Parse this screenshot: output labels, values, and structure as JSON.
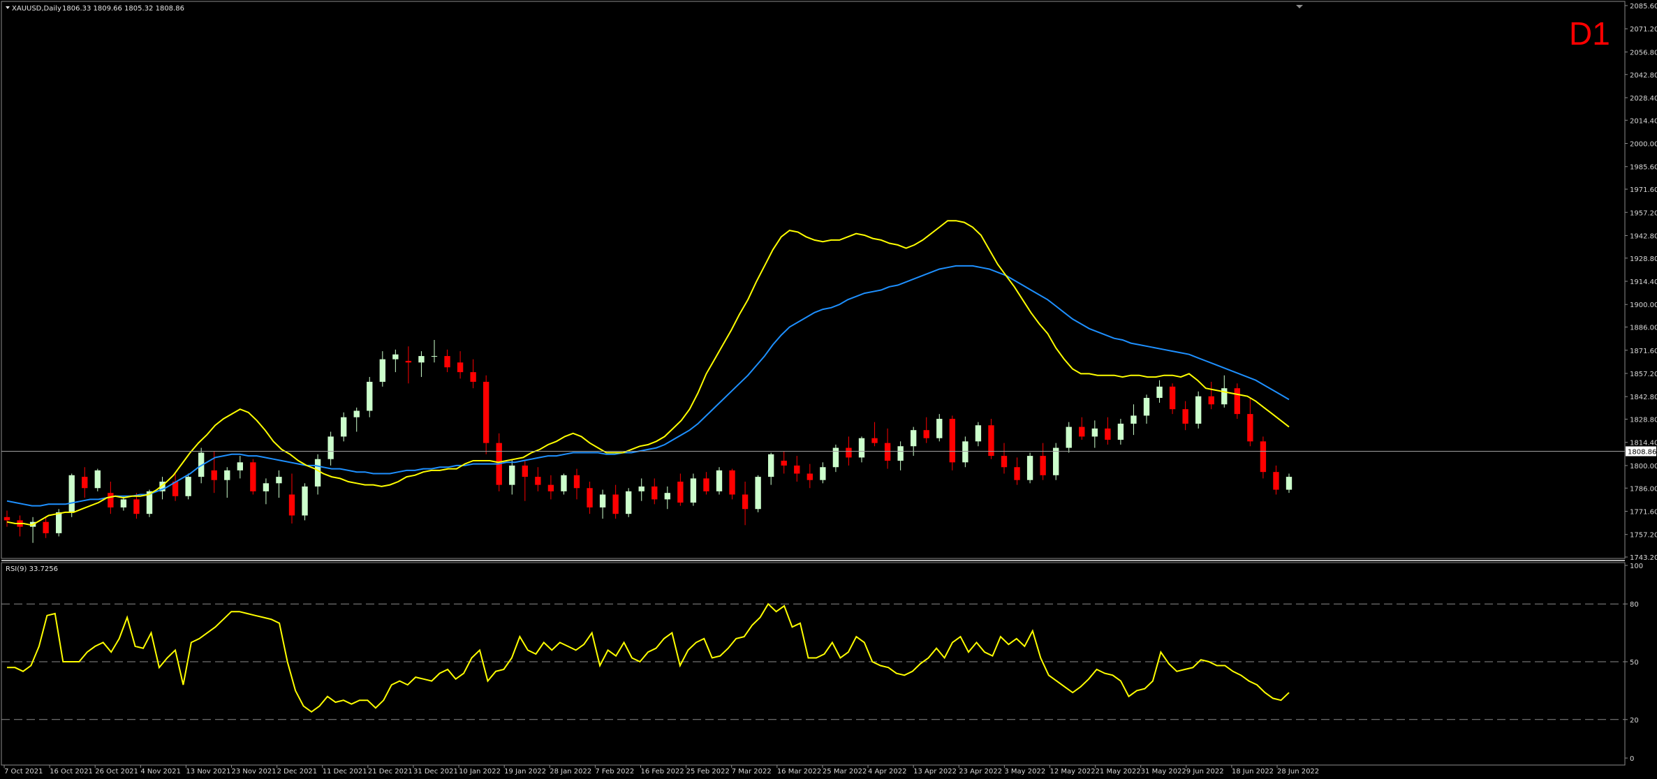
{
  "header": {
    "symbol_label": "XAUUSD,Daily",
    "ohlc": "1806.33 1809.66 1805.32 1808.86",
    "timeframe_badge": "D1",
    "collapse_arrow": "triangle-down-icon"
  },
  "price_panel": {
    "current_price_label": "1808.86",
    "y_tick_labels": [
      "2085.60",
      "2071.20",
      "2056.80",
      "2042.80",
      "2028.40",
      "2014.40",
      "2000.00",
      "1985.60",
      "1971.60",
      "1957.20",
      "1942.80",
      "1928.80",
      "1914.40",
      "1900.00",
      "1886.00",
      "1871.60",
      "1857.20",
      "1842.80",
      "1828.80",
      "1814.40",
      "1800.00",
      "1786.00",
      "1771.60",
      "1757.20",
      "1743.20"
    ]
  },
  "rsi_panel": {
    "label": "RSI(9) 33.7256",
    "y_tick_labels": [
      "100",
      "80",
      "50",
      "20",
      "0"
    ]
  },
  "x_tick_labels": [
    "7 Oct 2021",
    "16 Oct 2021",
    "26 Oct 2021",
    "4 Nov 2021",
    "13 Nov 2021",
    "23 Nov 2021",
    "2 Dec 2021",
    "11 Dec 2021",
    "21 Dec 2021",
    "31 Dec 2021",
    "10 Jan 2022",
    "19 Jan 2022",
    "28 Jan 2022",
    "7 Feb 2022",
    "16 Feb 2022",
    "25 Feb 2022",
    "7 Mar 2022",
    "16 Mar 2022",
    "25 Mar 2022",
    "4 Apr 2022",
    "13 Apr 2022",
    "23 Apr 2022",
    "3 May 2022",
    "12 May 2022",
    "21 May 2022",
    "31 May 2022",
    "9 Jun 2022",
    "18 Jun 2022",
    "28 Jun 2022"
  ],
  "colors": {
    "background": "#000000",
    "bull_candle": "#ccffcc",
    "bear_candle": "#ff0000",
    "fast_ma": "#ffff00",
    "slow_ma": "#1e90ff",
    "rsi_line": "#ffff00",
    "grid_dash": "#8c8c8c",
    "price_line": "#a0a0a0",
    "timeframe_badge": "#ff0000"
  },
  "chart_data": [
    {
      "type": "candlestick",
      "title": "XAUUSD,Daily",
      "ylim": [
        1743.2,
        2085.6
      ],
      "series": [
        {
          "name": "fast MA",
          "color": "#ffff00",
          "values": [
            1765,
            1764,
            1764,
            1763,
            1766,
            1769,
            1770,
            1771,
            1771,
            1773,
            1775,
            1777,
            1780,
            1781,
            1780,
            1781,
            1781,
            1782,
            1785,
            1789,
            1794,
            1801,
            1808,
            1814,
            1819,
            1825,
            1829,
            1832,
            1835,
            1833,
            1828,
            1822,
            1815,
            1810,
            1807,
            1803,
            1800,
            1798,
            1795,
            1793,
            1792,
            1790,
            1789,
            1788,
            1788,
            1787,
            1788,
            1790,
            1793,
            1794,
            1796,
            1797,
            1797,
            1798,
            1798,
            1801,
            1803,
            1803,
            1803,
            1802,
            1803,
            1804,
            1805,
            1808,
            1810,
            1813,
            1815,
            1818,
            1820,
            1818,
            1814,
            1811,
            1808,
            1808,
            1808,
            1810,
            1812,
            1813,
            1815,
            1818,
            1823,
            1828,
            1835,
            1845,
            1857,
            1866,
            1875,
            1884,
            1894,
            1903,
            1914,
            1924,
            1934,
            1942,
            1946,
            1945,
            1942,
            1940,
            1939,
            1940,
            1940,
            1942,
            1944,
            1943,
            1941,
            1940,
            1938,
            1937,
            1935,
            1937,
            1940,
            1944,
            1948,
            1952,
            1952,
            1951,
            1948,
            1943,
            1934,
            1925,
            1918,
            1911,
            1903,
            1895,
            1888,
            1882,
            1873,
            1866,
            1860,
            1857,
            1857,
            1856,
            1856,
            1856,
            1855,
            1856,
            1856,
            1855,
            1855,
            1856,
            1856,
            1855,
            1857,
            1853,
            1848,
            1847,
            1846,
            1845,
            1844,
            1843,
            1840,
            1836,
            1832,
            1828,
            1824
          ]
        },
        {
          "name": "slow MA",
          "color": "#1e90ff",
          "values": [
            1778,
            1777,
            1776,
            1775,
            1775,
            1776,
            1776,
            1776,
            1777,
            1778,
            1779,
            1779,
            1780,
            1781,
            1781,
            1781,
            1782,
            1782,
            1784,
            1786,
            1789,
            1792,
            1795,
            1799,
            1802,
            1805,
            1806,
            1807,
            1807,
            1806,
            1806,
            1805,
            1804,
            1803,
            1802,
            1801,
            1800,
            1800,
            1799,
            1798,
            1798,
            1797,
            1796,
            1796,
            1795,
            1795,
            1795,
            1796,
            1797,
            1797,
            1798,
            1798,
            1799,
            1799,
            1800,
            1800,
            1801,
            1801,
            1801,
            1801,
            1802,
            1802,
            1803,
            1804,
            1805,
            1806,
            1806,
            1807,
            1808,
            1808,
            1808,
            1808,
            1807,
            1807,
            1808,
            1808,
            1809,
            1810,
            1811,
            1813,
            1816,
            1819,
            1822,
            1826,
            1831,
            1836,
            1841,
            1846,
            1851,
            1856,
            1862,
            1868,
            1875,
            1881,
            1886,
            1889,
            1892,
            1895,
            1897,
            1898,
            1900,
            1903,
            1905,
            1907,
            1908,
            1909,
            1911,
            1912,
            1914,
            1916,
            1918,
            1920,
            1922,
            1923,
            1924,
            1924,
            1924,
            1923,
            1922,
            1920,
            1918,
            1915,
            1912,
            1909,
            1906,
            1903,
            1899,
            1895,
            1891,
            1888,
            1885,
            1883,
            1881,
            1879,
            1878,
            1876,
            1875,
            1874,
            1873,
            1872,
            1871,
            1870,
            1869,
            1867,
            1865,
            1863,
            1861,
            1859,
            1857,
            1855,
            1853,
            1850,
            1847,
            1844,
            1841
          ]
        }
      ],
      "candles": [
        [
          1768,
          1772,
          1762,
          1766
        ],
        [
          1766,
          1769,
          1756,
          1762
        ],
        [
          1762,
          1768,
          1752,
          1765
        ],
        [
          1765,
          1768,
          1755,
          1758
        ],
        [
          1758,
          1773,
          1756,
          1771
        ],
        [
          1771,
          1795,
          1768,
          1794
        ],
        [
          1793,
          1799,
          1780,
          1786
        ],
        [
          1786,
          1798,
          1784,
          1797
        ],
        [
          1783,
          1790,
          1770,
          1774
        ],
        [
          1774,
          1781,
          1772,
          1779
        ],
        [
          1779,
          1783,
          1767,
          1770
        ],
        [
          1770,
          1785,
          1768,
          1784
        ],
        [
          1784,
          1793,
          1779,
          1790
        ],
        [
          1790,
          1796,
          1778,
          1781
        ],
        [
          1781,
          1795,
          1779,
          1793
        ],
        [
          1793,
          1811,
          1789,
          1808
        ],
        [
          1797,
          1809,
          1783,
          1791
        ],
        [
          1791,
          1799,
          1780,
          1797
        ],
        [
          1797,
          1806,
          1792,
          1802
        ],
        [
          1802,
          1804,
          1782,
          1784
        ],
        [
          1784,
          1792,
          1776,
          1789
        ],
        [
          1789,
          1797,
          1780,
          1793
        ],
        [
          1782,
          1795,
          1764,
          1769
        ],
        [
          1769,
          1789,
          1766,
          1787
        ],
        [
          1787,
          1807,
          1782,
          1804
        ],
        [
          1804,
          1821,
          1800,
          1818
        ],
        [
          1818,
          1833,
          1815,
          1830
        ],
        [
          1830,
          1836,
          1821,
          1834
        ],
        [
          1834,
          1855,
          1830,
          1852
        ],
        [
          1852,
          1871,
          1849,
          1866
        ],
        [
          1866,
          1872,
          1858,
          1869
        ],
        [
          1865,
          1874,
          1851,
          1864
        ],
        [
          1864,
          1871,
          1855,
          1868
        ],
        [
          1868,
          1878,
          1864,
          1868
        ],
        [
          1868,
          1872,
          1858,
          1861
        ],
        [
          1864,
          1871,
          1854,
          1858
        ],
        [
          1858,
          1866,
          1848,
          1852
        ],
        [
          1852,
          1856,
          1807,
          1814
        ],
        [
          1814,
          1820,
          1784,
          1788
        ],
        [
          1788,
          1804,
          1782,
          1800
        ],
        [
          1800,
          1803,
          1778,
          1793
        ],
        [
          1793,
          1799,
          1784,
          1788
        ],
        [
          1788,
          1794,
          1779,
          1784
        ],
        [
          1784,
          1795,
          1782,
          1794
        ],
        [
          1794,
          1798,
          1779,
          1786
        ],
        [
          1786,
          1790,
          1770,
          1774
        ],
        [
          1774,
          1785,
          1767,
          1782
        ],
        [
          1782,
          1788,
          1767,
          1770
        ],
        [
          1770,
          1786,
          1768,
          1784
        ],
        [
          1784,
          1792,
          1778,
          1787
        ],
        [
          1787,
          1792,
          1776,
          1779
        ],
        [
          1779,
          1787,
          1773,
          1783
        ],
        [
          1790,
          1795,
          1775,
          1777
        ],
        [
          1777,
          1795,
          1775,
          1792
        ],
        [
          1792,
          1796,
          1782,
          1784
        ],
        [
          1784,
          1799,
          1782,
          1797
        ],
        [
          1797,
          1798,
          1779,
          1782
        ],
        [
          1782,
          1790,
          1763,
          1773
        ],
        [
          1773,
          1794,
          1771,
          1793
        ],
        [
          1793,
          1808,
          1788,
          1807
        ],
        [
          1803,
          1809,
          1795,
          1800
        ],
        [
          1800,
          1806,
          1790,
          1795
        ],
        [
          1795,
          1801,
          1786,
          1791
        ],
        [
          1791,
          1802,
          1789,
          1799
        ],
        [
          1799,
          1813,
          1796,
          1811
        ],
        [
          1811,
          1818,
          1800,
          1805
        ],
        [
          1805,
          1818,
          1802,
          1817
        ],
        [
          1817,
          1827,
          1812,
          1814
        ],
        [
          1814,
          1823,
          1798,
          1803
        ],
        [
          1803,
          1815,
          1797,
          1812
        ],
        [
          1812,
          1824,
          1806,
          1822
        ],
        [
          1822,
          1830,
          1814,
          1817
        ],
        [
          1817,
          1832,
          1815,
          1829
        ],
        [
          1829,
          1831,
          1797,
          1802
        ],
        [
          1802,
          1818,
          1799,
          1815
        ],
        [
          1815,
          1827,
          1812,
          1825
        ],
        [
          1825,
          1829,
          1804,
          1806
        ],
        [
          1806,
          1814,
          1795,
          1799
        ],
        [
          1799,
          1805,
          1788,
          1791
        ],
        [
          1791,
          1808,
          1789,
          1806
        ],
        [
          1806,
          1814,
          1791,
          1794
        ],
        [
          1794,
          1814,
          1791,
          1811
        ],
        [
          1811,
          1827,
          1808,
          1824
        ],
        [
          1824,
          1830,
          1816,
          1818
        ],
        [
          1818,
          1828,
          1811,
          1823
        ],
        [
          1823,
          1830,
          1813,
          1816
        ],
        [
          1816,
          1829,
          1813,
          1826
        ],
        [
          1826,
          1838,
          1819,
          1831
        ],
        [
          1831,
          1844,
          1826,
          1842
        ],
        [
          1842,
          1853,
          1839,
          1849
        ],
        [
          1849,
          1851,
          1832,
          1835
        ],
        [
          1835,
          1840,
          1822,
          1826
        ],
        [
          1826,
          1846,
          1823,
          1843
        ],
        [
          1843,
          1852,
          1835,
          1838
        ],
        [
          1838,
          1856,
          1836,
          1848
        ],
        [
          1848,
          1851,
          1829,
          1832
        ],
        [
          1832,
          1842,
          1812,
          1815
        ],
        [
          1815,
          1818,
          1792,
          1796
        ],
        [
          1796,
          1800,
          1782,
          1785
        ],
        [
          1785,
          1795,
          1783,
          1793
        ]
      ]
    },
    {
      "type": "line",
      "title": "RSI(9) 33.7256",
      "ylim": [
        0,
        100
      ],
      "series": [
        {
          "name": "RSI(9)",
          "color": "#ffff00",
          "values": [
            47,
            47,
            45,
            48,
            58,
            74,
            75,
            50,
            50,
            50,
            55,
            58,
            60,
            55,
            62,
            73,
            58,
            57,
            65,
            47,
            52,
            56,
            38,
            60,
            62,
            65,
            68,
            72,
            76,
            76,
            75,
            74,
            73,
            72,
            70,
            50,
            35,
            27,
            24,
            27,
            32,
            29,
            30,
            28,
            30,
            30,
            26,
            30,
            38,
            40,
            38,
            42,
            41,
            40,
            44,
            46,
            41,
            44,
            52,
            56,
            40,
            45,
            46,
            52,
            63,
            56,
            54,
            60,
            56,
            60,
            58,
            56,
            59,
            65,
            48,
            56,
            53,
            60,
            52,
            50,
            55,
            57,
            62,
            65,
            48,
            56,
            60,
            62,
            52,
            53,
            57,
            62,
            63,
            69,
            73,
            80,
            76,
            79,
            68,
            70,
            52,
            52,
            54,
            60,
            52,
            55,
            63,
            60,
            50,
            48,
            47,
            44,
            43,
            45,
            49,
            52,
            57,
            52,
            60,
            63,
            55,
            60,
            55,
            53,
            63,
            59,
            62,
            58,
            66,
            52,
            43,
            40,
            37,
            34,
            37,
            41,
            46,
            44,
            43,
            40,
            32,
            35,
            36,
            40,
            55,
            49,
            45,
            46,
            47,
            51,
            50,
            48,
            48,
            45,
            43,
            40,
            38,
            34,
            31,
            30,
            34
          ]
        }
      ]
    }
  ]
}
